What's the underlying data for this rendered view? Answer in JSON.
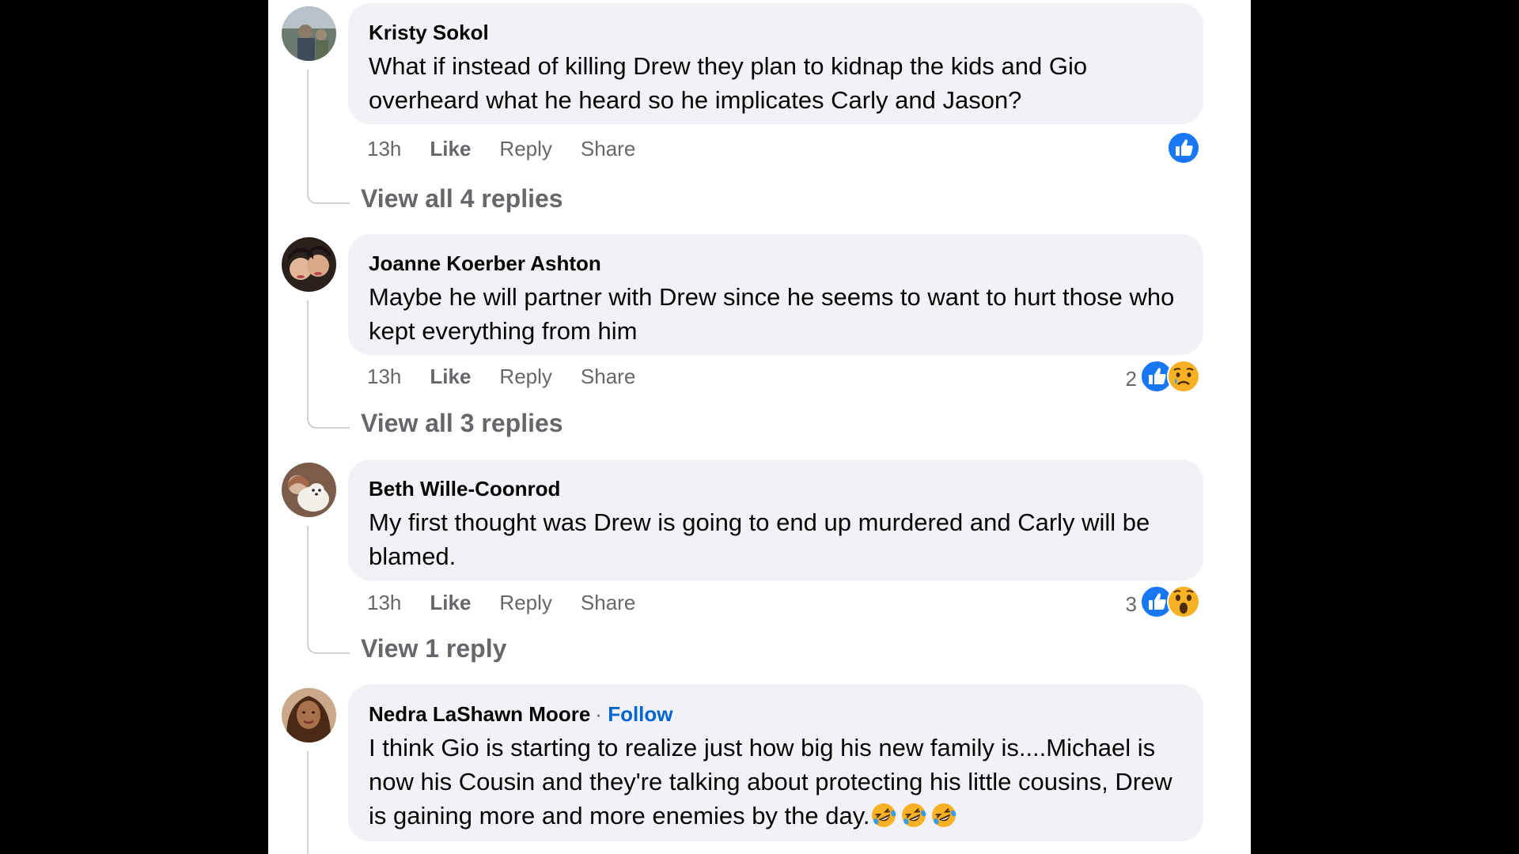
{
  "comments": [
    {
      "author": "Kristy Sokol",
      "text": "What if instead of killing Drew they plan to kidnap the kids and Gio overheard what he heard so he implicates Carly and Jason?",
      "time": "13h",
      "like": "Like",
      "reply": "Reply",
      "share": "Share",
      "reaction_count": "",
      "reactions": [
        "like"
      ],
      "view_replies": "View all 4 replies"
    },
    {
      "author": "Joanne Koerber Ashton",
      "text": "Maybe he will partner with Drew since he seems to want to hurt those who kept everything from him",
      "time": "13h",
      "like": "Like",
      "reply": "Reply",
      "share": "Share",
      "reaction_count": "2",
      "reactions": [
        "like",
        "sad"
      ],
      "view_replies": "View all 3 replies"
    },
    {
      "author": "Beth Wille-Coonrod",
      "text": "My first thought was Drew is going to end up murdered and Carly will be blamed.",
      "time": "13h",
      "like": "Like",
      "reply": "Reply",
      "share": "Share",
      "reaction_count": "3",
      "reactions": [
        "like",
        "wow"
      ],
      "view_replies": "View 1 reply"
    },
    {
      "author": "Nedra LaShawn Moore",
      "separator": "·",
      "follow": "Follow",
      "text": "I think Gio is starting to realize just how big his new family is....Michael is now his Cousin and they're talking about protecting his little cousins, Drew is gaining more and more enemies by the day.",
      "emoji_suffix": [
        "rolling-laughing-emoji",
        "rolling-laughing-emoji",
        "rolling-laughing-emoji"
      ]
    }
  ],
  "colors": {
    "like_blue": "#1877f2",
    "link_blue": "#0064d1",
    "bubble_bg": "#f0f2f5",
    "secondary_text": "#65676b"
  }
}
